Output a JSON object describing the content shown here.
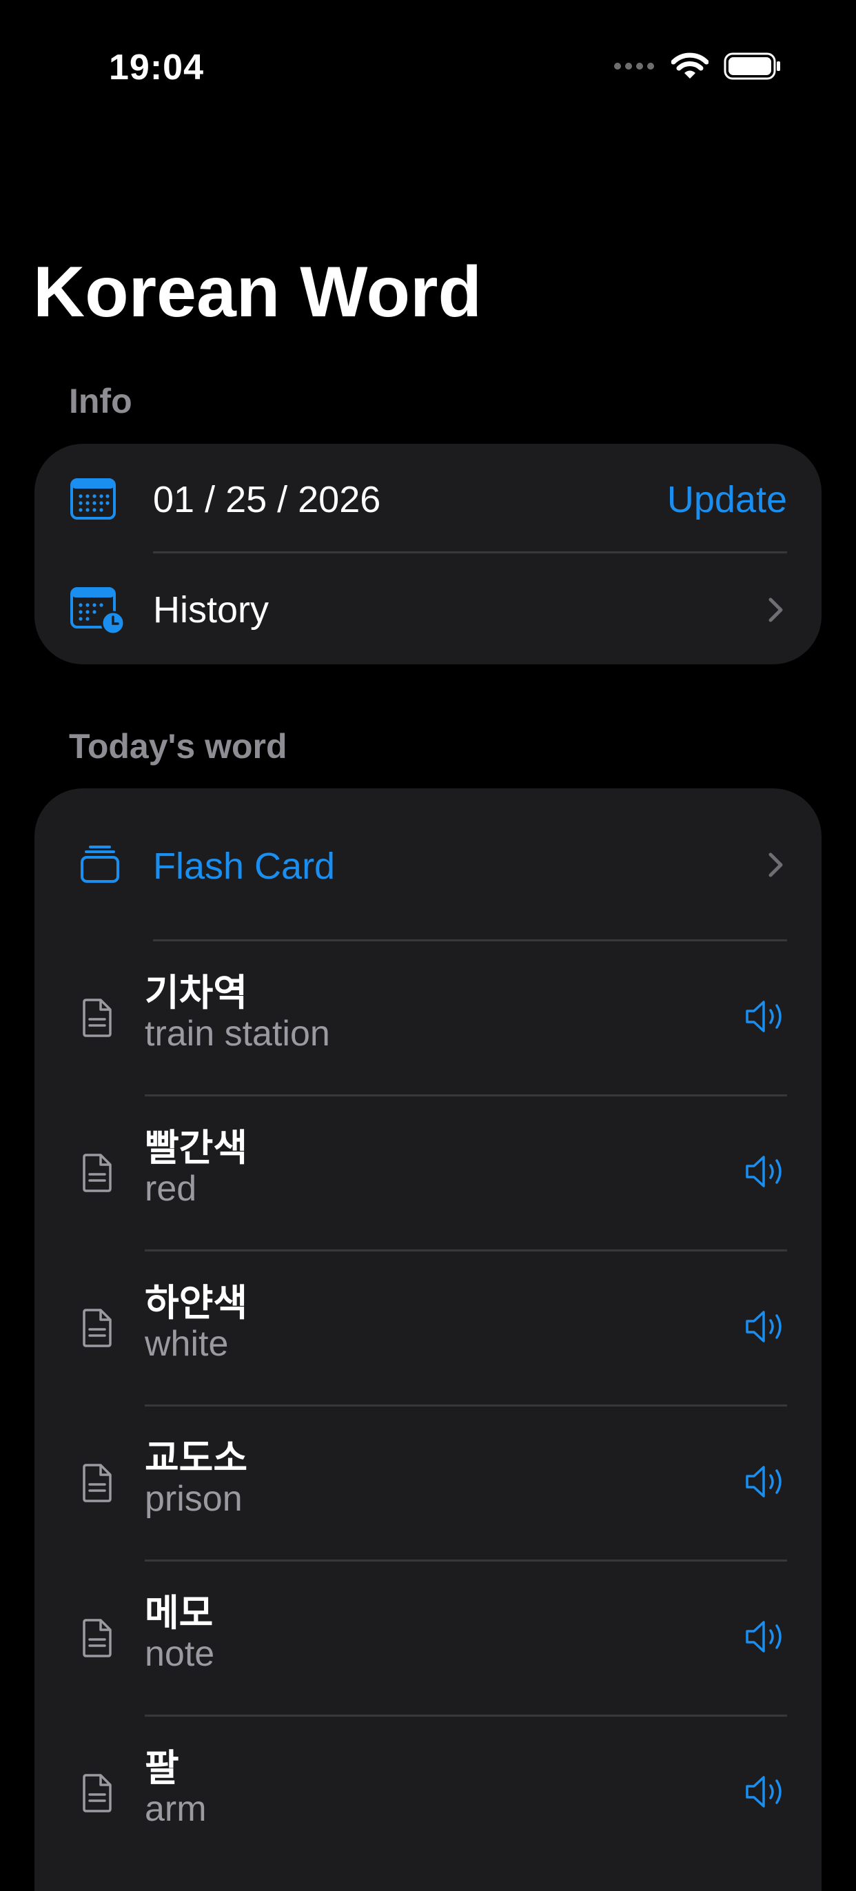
{
  "status_bar": {
    "time": "19:04"
  },
  "title": "Korean Word",
  "info_section": {
    "header": "Info",
    "date": "01 / 25 / 2026",
    "update_label": "Update",
    "history_label": "History"
  },
  "today_section": {
    "header": "Today's word",
    "flash_card_label": "Flash Card",
    "words": [
      {
        "korean": "기차역",
        "english": "train station"
      },
      {
        "korean": "빨간색",
        "english": "red"
      },
      {
        "korean": "하얀색",
        "english": "white"
      },
      {
        "korean": "교도소",
        "english": "prison"
      },
      {
        "korean": "메모",
        "english": "note"
      },
      {
        "korean": "팔",
        "english": "arm"
      }
    ]
  },
  "colors": {
    "accent": "#1b8ff0",
    "card_background": "#1c1c1e",
    "secondary_text": "#9a9aa0",
    "section_header": "#8d8d93"
  },
  "icons": {
    "date_row": "calendar-icon",
    "history_row": "calendar-clock-icon",
    "flash_card_row": "card-stack-icon",
    "word_row": "document-icon",
    "word_action": "speaker-icon",
    "disclosure": "chevron-right-icon"
  }
}
